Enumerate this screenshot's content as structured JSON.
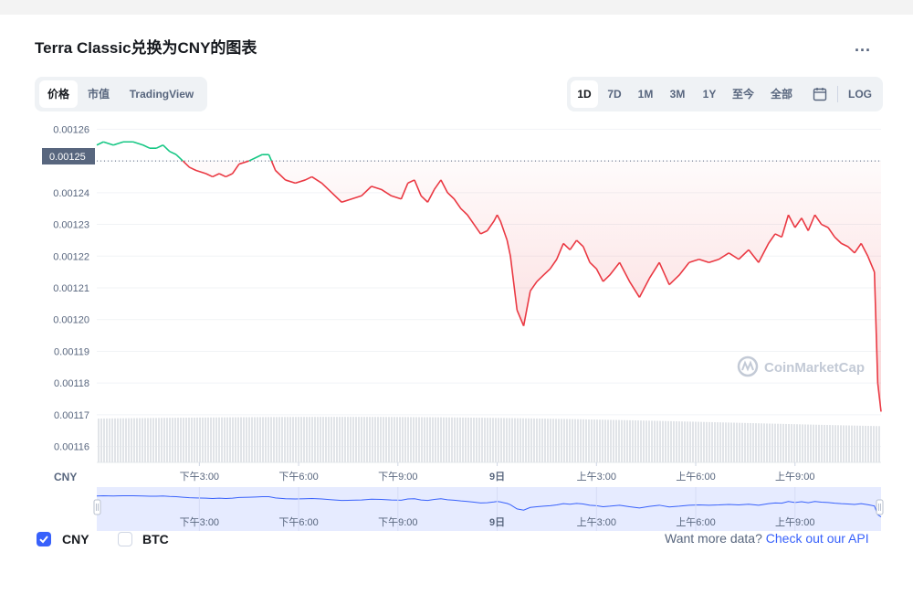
{
  "page": {
    "title": "Terra Classic兑换为CNY的图表",
    "more_label": "..."
  },
  "tabs": [
    {
      "label": "价格",
      "active": true
    },
    {
      "label": "市值",
      "active": false
    },
    {
      "label": "TradingView",
      "active": false
    }
  ],
  "ranges": [
    {
      "label": "1D",
      "active": true
    },
    {
      "label": "7D",
      "active": false
    },
    {
      "label": "1M",
      "active": false
    },
    {
      "label": "3M",
      "active": false
    },
    {
      "label": "1Y",
      "active": false
    },
    {
      "label": "至今",
      "active": false
    },
    {
      "label": "全部",
      "active": false
    }
  ],
  "calendar_icon": "calendar-icon",
  "log_label": "LOG",
  "colors": {
    "up": "#16c784",
    "down": "#ea3943",
    "accent": "#3861fb",
    "navigator_fill": "#e6ebff",
    "volume": "#e1e4e8"
  },
  "chart_data": {
    "type": "line",
    "currency_label": "CNY",
    "reference_value": 0.00125,
    "reference_label": "0.00125",
    "ylim": [
      0.001155,
      0.001265
    ],
    "y_ticks": [
      "0.00126",
      "0.00125",
      "0.00124",
      "0.00123",
      "0.00122",
      "0.00121",
      "0.00120",
      "0.00119",
      "0.00118",
      "0.00117",
      "0.00116"
    ],
    "x_ticks": [
      "下午3:00",
      "下午6:00",
      "下午9:00",
      "9日",
      "上午3:00",
      "上午6:00",
      "上午9:00"
    ],
    "x_tick_hours": [
      15,
      18,
      21,
      24,
      27,
      30,
      33
    ],
    "x_range_hours": [
      11.9,
      35.6
    ],
    "series": [
      {
        "x": [
          11.9,
          12.1,
          12.4,
          12.7,
          13.0,
          13.3,
          13.5,
          13.7,
          13.9,
          14.1,
          14.3,
          14.5,
          14.7,
          14.9,
          15.2,
          15.4,
          15.6,
          15.8,
          16.0,
          16.2,
          16.5,
          16.7,
          16.9,
          17.1,
          17.3,
          17.6,
          17.9,
          18.2,
          18.4,
          18.7,
          19.0,
          19.3,
          19.6,
          19.9,
          20.2,
          20.5,
          20.8,
          21.1,
          21.3,
          21.5,
          21.7,
          21.9,
          22.1,
          22.3,
          22.5,
          22.7,
          22.9,
          23.1,
          23.3,
          23.5,
          23.7,
          23.9,
          24.0,
          24.1,
          24.2,
          24.3,
          24.4,
          24.6,
          24.8,
          25.0,
          25.2,
          25.4,
          25.6,
          25.8,
          26.0,
          26.2,
          26.4,
          26.6,
          26.8,
          27.0,
          27.2,
          27.4,
          27.7,
          28.0,
          28.3,
          28.6,
          28.9,
          29.2,
          29.5,
          29.8,
          30.1,
          30.4,
          30.7,
          31.0,
          31.3,
          31.6,
          31.9,
          32.2,
          32.4,
          32.6,
          32.8,
          33.0,
          33.2,
          33.4,
          33.6,
          33.8,
          34.0,
          34.2,
          34.4,
          34.6,
          34.8,
          35.0,
          35.2,
          35.4,
          35.5,
          35.6
        ],
        "y": [
          0.001255,
          0.001256,
          0.001255,
          0.001256,
          0.001256,
          0.001255,
          0.001254,
          0.001254,
          0.001255,
          0.001253,
          0.001252,
          0.00125,
          0.001248,
          0.001247,
          0.001246,
          0.001245,
          0.001246,
          0.001245,
          0.001246,
          0.001249,
          0.00125,
          0.001251,
          0.001252,
          0.001252,
          0.001247,
          0.001244,
          0.001243,
          0.001244,
          0.001245,
          0.001243,
          0.00124,
          0.001237,
          0.001238,
          0.001239,
          0.001242,
          0.001241,
          0.001239,
          0.001238,
          0.001243,
          0.001244,
          0.001239,
          0.001237,
          0.001241,
          0.001244,
          0.00124,
          0.001238,
          0.001235,
          0.001233,
          0.00123,
          0.001227,
          0.001228,
          0.001231,
          0.001233,
          0.001231,
          0.001228,
          0.001225,
          0.00122,
          0.001203,
          0.001198,
          0.001209,
          0.001212,
          0.001214,
          0.001216,
          0.001219,
          0.001224,
          0.001222,
          0.001225,
          0.001223,
          0.001218,
          0.001216,
          0.001212,
          0.001214,
          0.001218,
          0.001212,
          0.001207,
          0.001213,
          0.001218,
          0.001211,
          0.001214,
          0.001218,
          0.001219,
          0.001218,
          0.001219,
          0.001221,
          0.001219,
          0.001222,
          0.001218,
          0.001224,
          0.001227,
          0.001226,
          0.001233,
          0.001229,
          0.001232,
          0.001228,
          0.001233,
          0.00123,
          0.001229,
          0.001226,
          0.001224,
          0.001223,
          0.001221,
          0.001224,
          0.00122,
          0.001215,
          0.00118,
          0.001171
        ]
      }
    ],
    "navigator_ticks": [
      "下午3:00",
      "下午6:00",
      "下午9:00",
      "9日",
      "上午3:00",
      "上午6:00",
      "上午9:00"
    ],
    "legend": [
      {
        "label": "CNY",
        "checked": true
      },
      {
        "label": "BTC",
        "checked": false
      }
    ]
  },
  "watermark": {
    "text": "CoinMarketCap",
    "icon": "coinmarketcap-logo-icon"
  },
  "footer": {
    "prompt": "Want more data?",
    "link": "Check out our API"
  }
}
